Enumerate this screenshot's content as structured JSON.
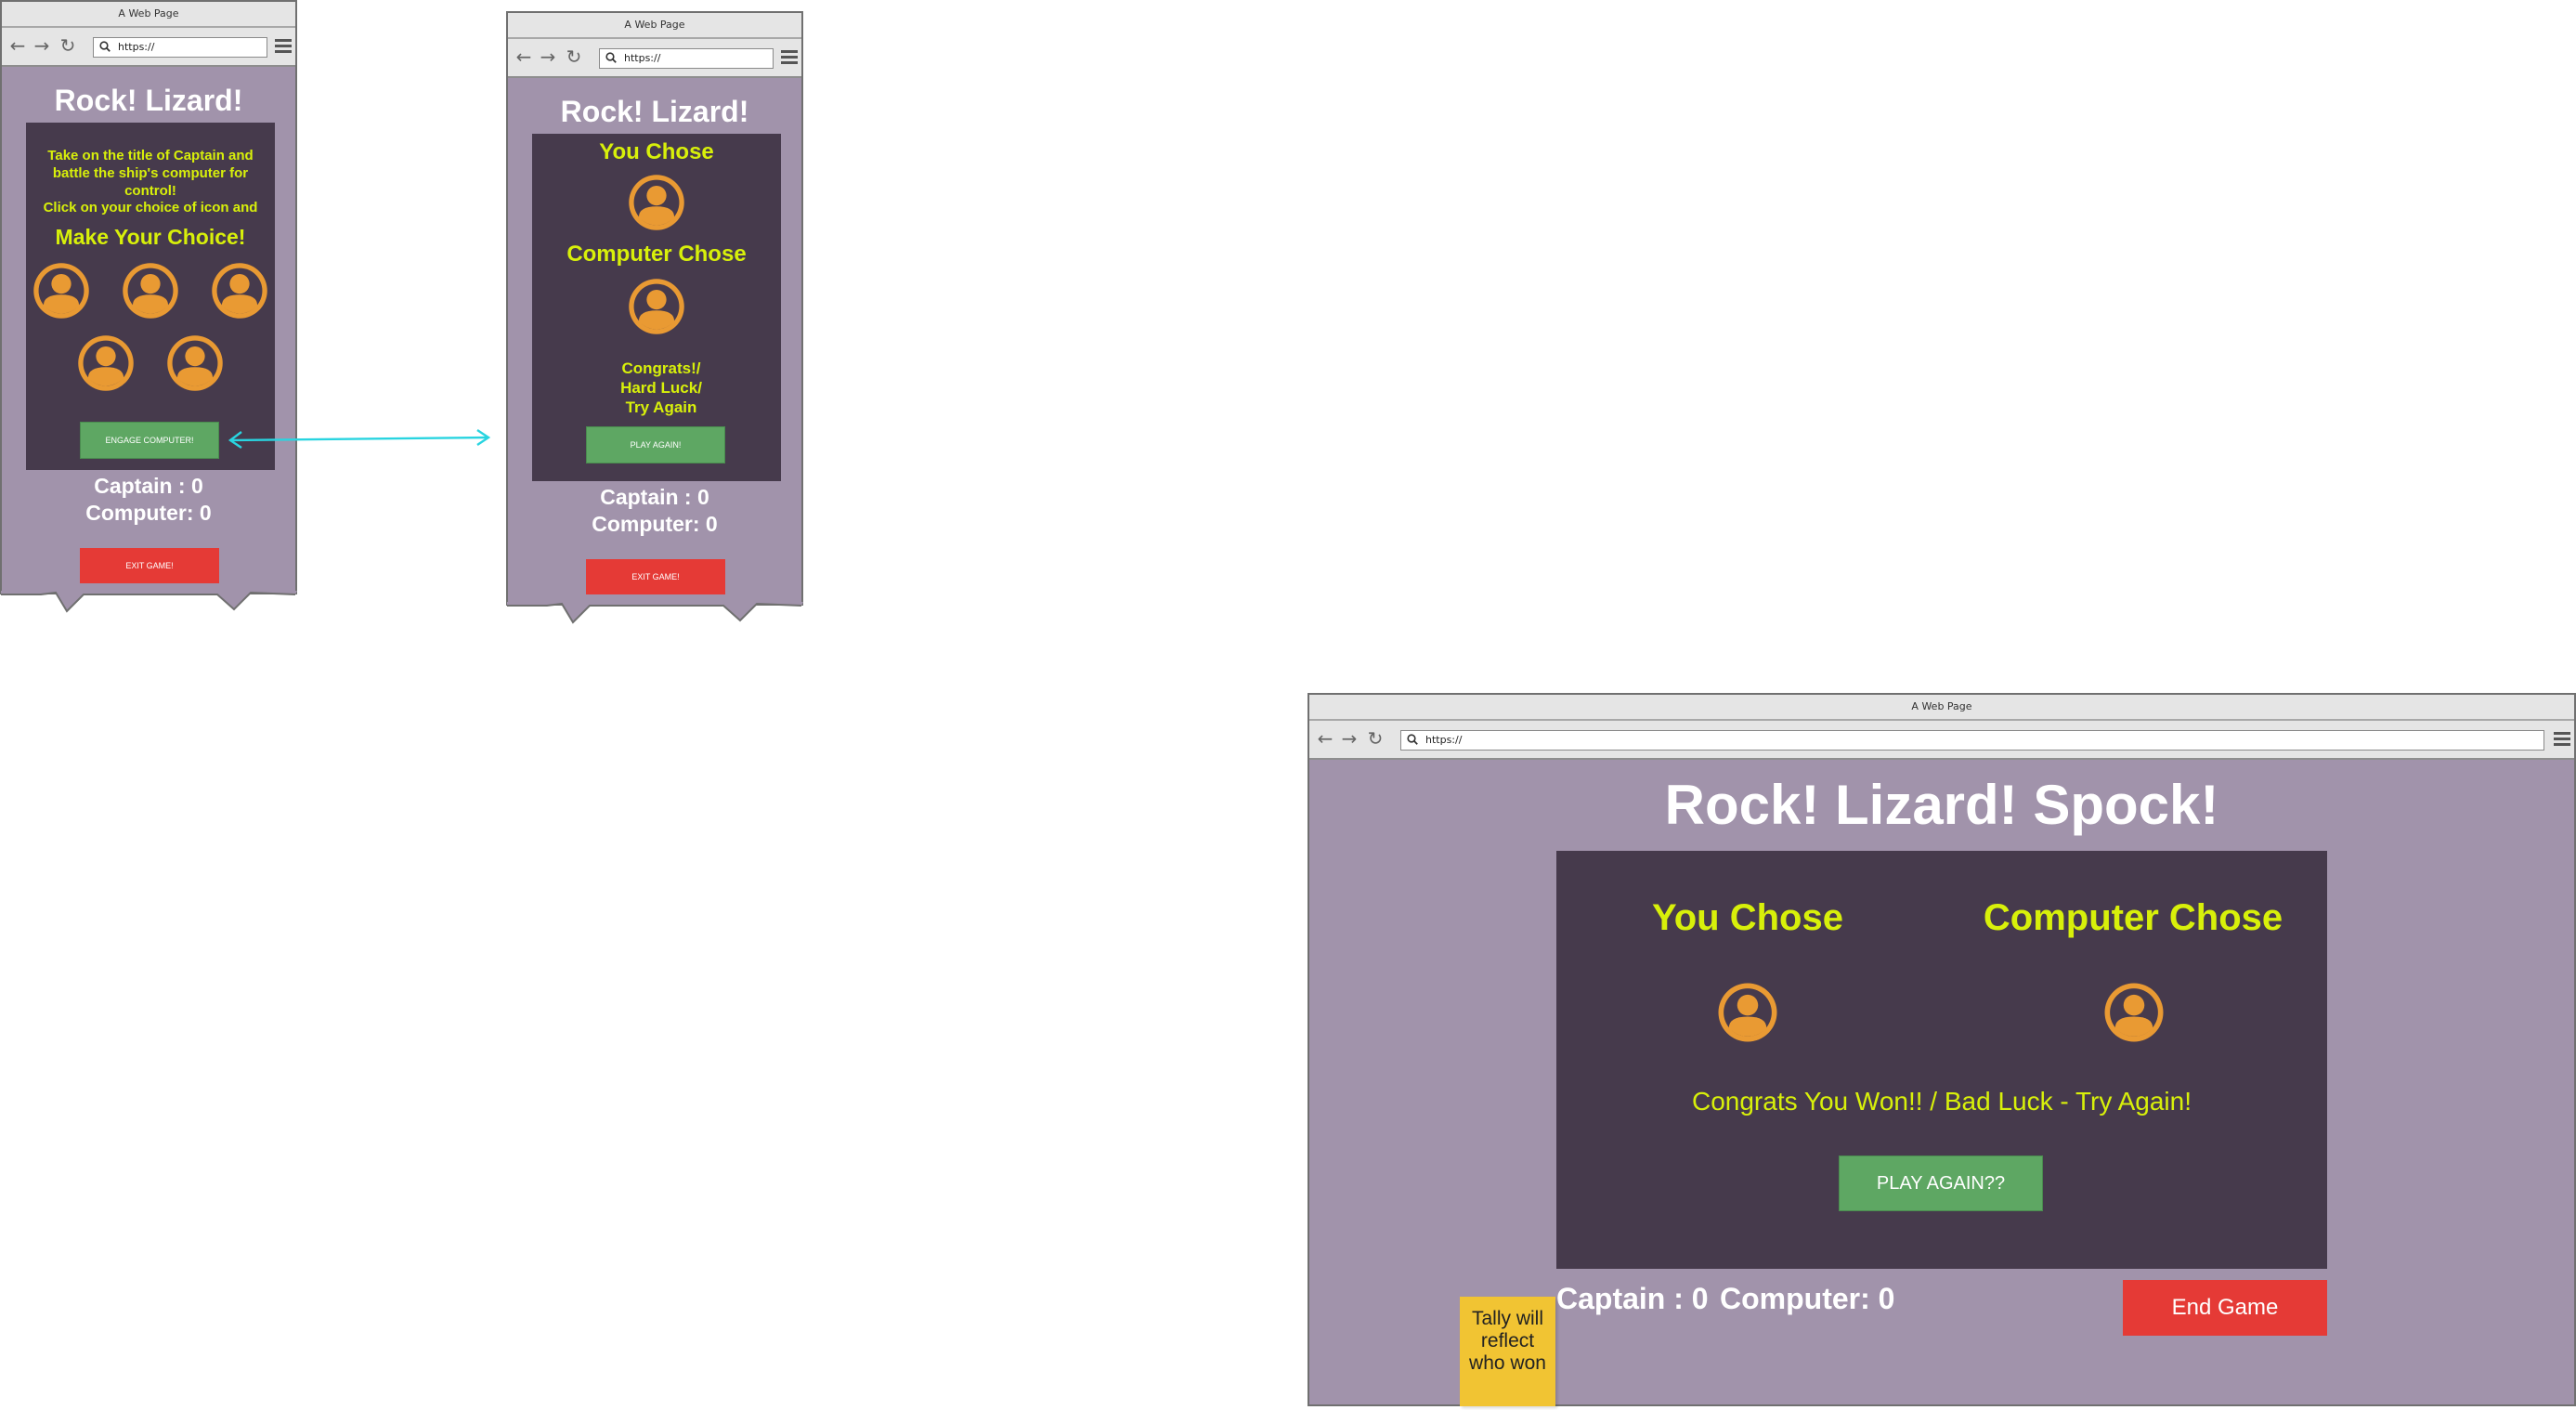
{
  "browser": {
    "window_title": "A Web Page",
    "url": "https://"
  },
  "game_title": "Rock! Lizard! Spock!",
  "mobile_start": {
    "intro_text": "Take on the title of Captain and battle the ship's computer for control!",
    "instruction_text": "Click on your choice of icon and",
    "prompt": "Make Your Choice!",
    "engage_label": "ENGAGE COMPUTER!",
    "captain_score": "Captain : 0",
    "computer_score": "Computer:  0",
    "exit_label": "EXIT GAME!"
  },
  "mobile_result": {
    "you_chose": "You Chose",
    "computer_chose": "Computer Chose",
    "result_line1": "Congrats!/",
    "result_line2": "Hard Luck/",
    "result_line3": "Try Again",
    "play_again_label": "PLAY AGAIN!",
    "captain_score": "Captain : 0",
    "computer_score": "Computer:  0",
    "exit_label": "EXIT GAME!"
  },
  "desktop_result": {
    "you_chose": "You Chose",
    "computer_chose": "Computer Chose",
    "result": "Congrats You Won!! /  Bad Luck - Try Again!",
    "play_again_label": "PLAY AGAIN??",
    "captain_score": "Captain : 0",
    "computer_score": "Computer:  0",
    "end_label": "End Game"
  },
  "sticky_note": {
    "line1": "Tally will",
    "line2": "reflect",
    "line3": "who won"
  },
  "colors": {
    "page_bg": "#a193ab",
    "panel_bg": "#463a4c",
    "accent_yellow": "#d8f00a",
    "avatar_orange": "#e99a33",
    "button_green": "#5ea763",
    "button_red": "#e53a36",
    "connector_cyan": "#29d4e0",
    "sticky_yellow": "#f1c433"
  },
  "icons": [
    "user-avatar-icon",
    "back-arrow-icon",
    "forward-arrow-icon",
    "reload-icon",
    "search-icon",
    "menu-icon"
  ]
}
